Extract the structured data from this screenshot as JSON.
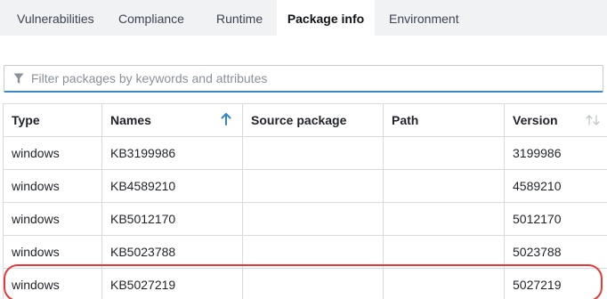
{
  "tabs": [
    {
      "label": "Vulnerabilities",
      "active": false
    },
    {
      "label": "Compliance",
      "active": false
    },
    {
      "label": "Runtime",
      "active": false
    },
    {
      "label": "Package info",
      "active": true
    },
    {
      "label": "Environment",
      "active": false
    }
  ],
  "filter": {
    "icon": "filter-icon",
    "placeholder": "Filter packages by keywords and attributes"
  },
  "table": {
    "columns": [
      {
        "label": "Type"
      },
      {
        "label": "Names",
        "sort": "ascending",
        "sort_color": "#2f86d3"
      },
      {
        "label": "Source package"
      },
      {
        "label": "Path"
      },
      {
        "label": "Version",
        "sort": "none"
      }
    ],
    "rows": [
      {
        "type": "windows",
        "name": "KB3199986",
        "source": "",
        "path": "",
        "version": "3199986"
      },
      {
        "type": "windows",
        "name": "KB4589210",
        "source": "",
        "path": "",
        "version": "4589210"
      },
      {
        "type": "windows",
        "name": "KB5012170",
        "source": "",
        "path": "",
        "version": "5012170"
      },
      {
        "type": "windows",
        "name": "KB5023788",
        "source": "",
        "path": "",
        "version": "5023788"
      },
      {
        "type": "windows",
        "name": "KB5027219",
        "source": "",
        "path": "",
        "version": "5027219",
        "highlighted": true
      }
    ]
  },
  "colors": {
    "accent": "#3b89c8",
    "highlight": "#e53935",
    "tab_bar": "#f1f2f4"
  }
}
